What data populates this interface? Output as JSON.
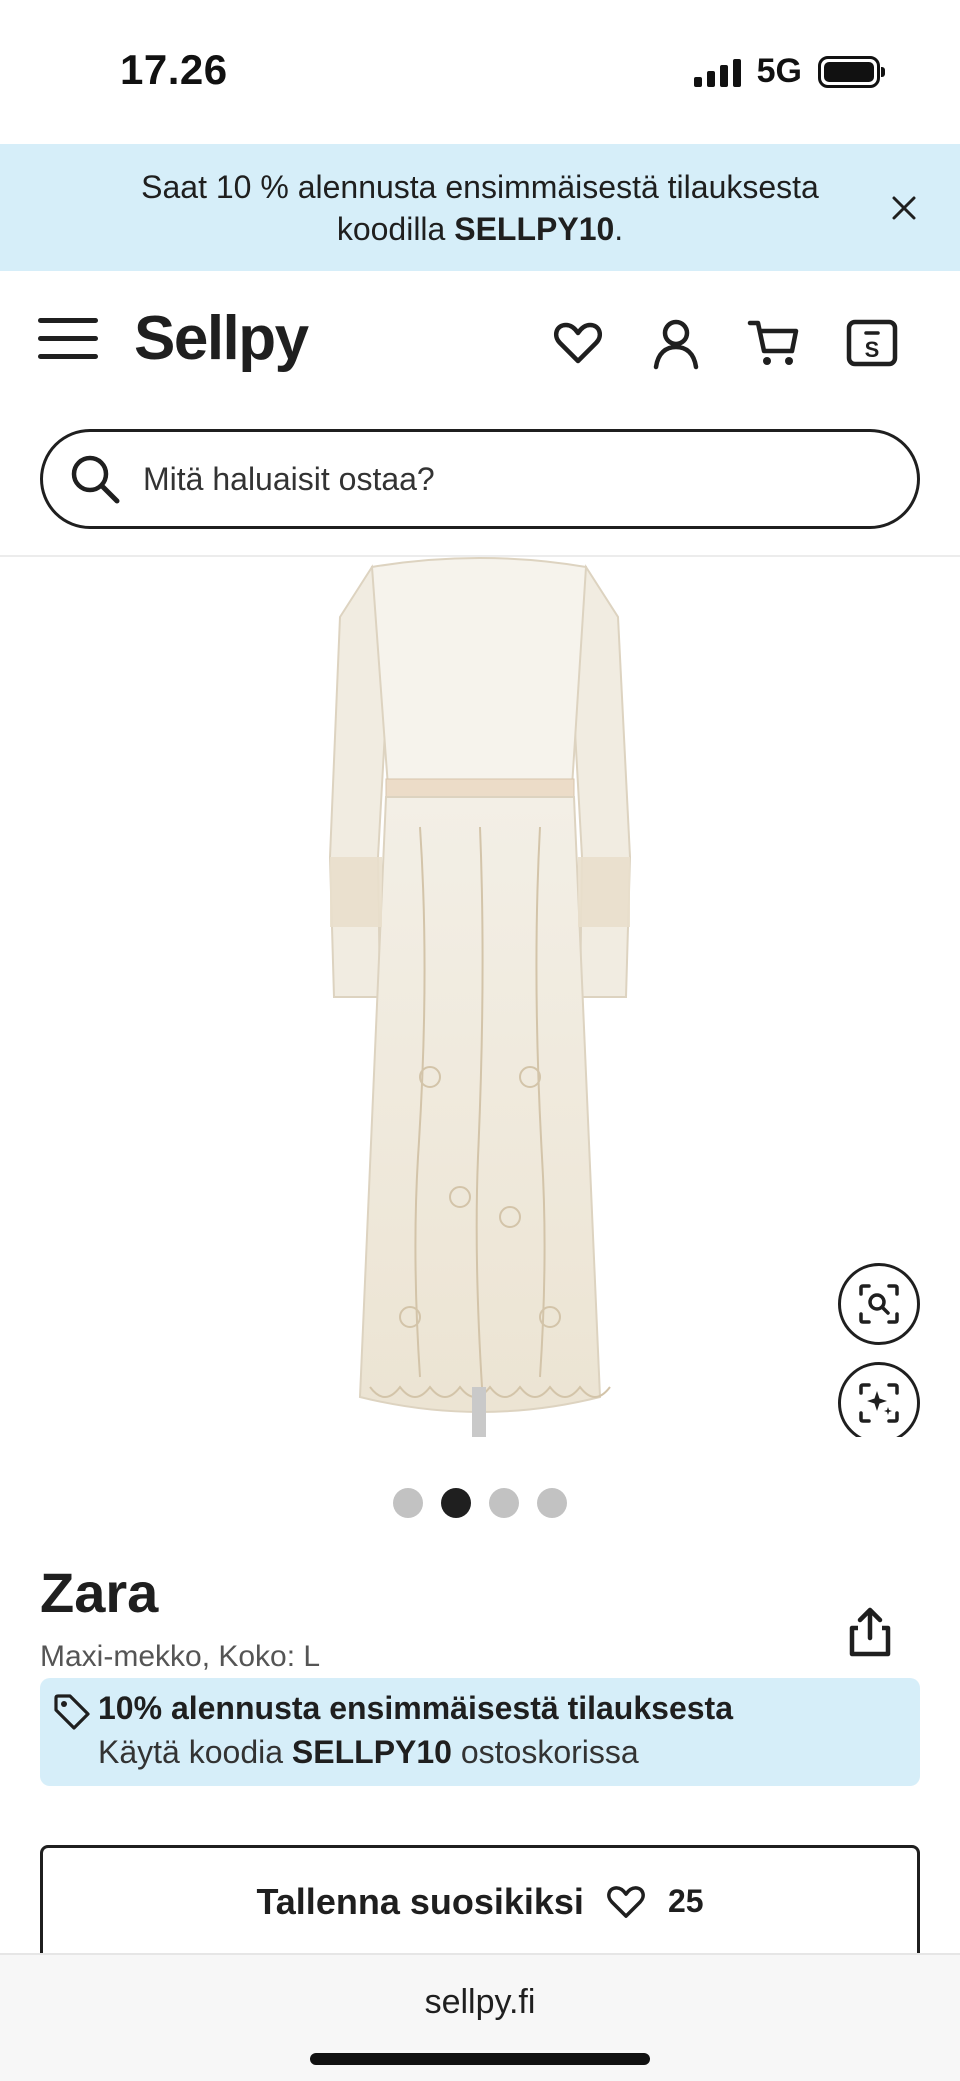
{
  "status_bar": {
    "time": "17.26",
    "network": "5G"
  },
  "promo_banner": {
    "text_before": "Saat 10 % alennusta ensimmäisestä tilauksesta koodilla ",
    "code": "SELLPY10",
    "text_after": "."
  },
  "header": {
    "logo": "Sellpy",
    "icons": [
      "menu-icon",
      "heart-icon",
      "user-icon",
      "cart-icon",
      "sellpy-bag-icon"
    ]
  },
  "search": {
    "placeholder": "Mitä haluaisit ostaa?"
  },
  "gallery": {
    "image_count": 4,
    "active_index": 1,
    "buttons": [
      "zoom-search-icon",
      "visual-search-icon"
    ]
  },
  "product": {
    "brand": "Zara",
    "subtitle": "Maxi-mekko, Koko: L"
  },
  "discount": {
    "title": "10% alennusta ensimmäisestä tilauksesta",
    "sub_before": "Käytä koodia ",
    "code": "SELLPY10",
    "sub_after": " ostoskorissa"
  },
  "favorite": {
    "label": "Tallenna suosikiksi",
    "count": "25"
  },
  "browser": {
    "url": "sellpy.fi"
  },
  "colors": {
    "promo_bg": "#d6eef9",
    "text": "#1f1f1f",
    "dot_inactive": "#c2c2c2"
  }
}
